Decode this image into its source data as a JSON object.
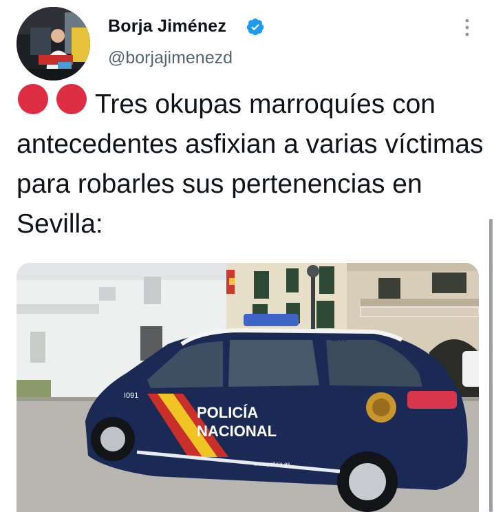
{
  "author": {
    "name": "Borja Jiménez",
    "handle": "@borjajimenezd",
    "verified": true,
    "avatar_icon": "avatar-photo"
  },
  "tweet": {
    "emoji": "red-circle-emoji x2",
    "text": "Tres okupas marroquíes con antecedentes asfixian a varias víctimas para robarles sus pertenencias en Sevilla:"
  },
  "media": {
    "car_badge_text": "POLICÍA NACIONAL",
    "car_code": "2R4",
    "car_side_code": "I091",
    "car_url": "www.policia.es",
    "description_icon": "police-car-photo"
  },
  "colors": {
    "text": "#0f1419",
    "secondary": "#536471",
    "verified": "#1d9bf0",
    "emoji_red": "#dd2e44"
  }
}
